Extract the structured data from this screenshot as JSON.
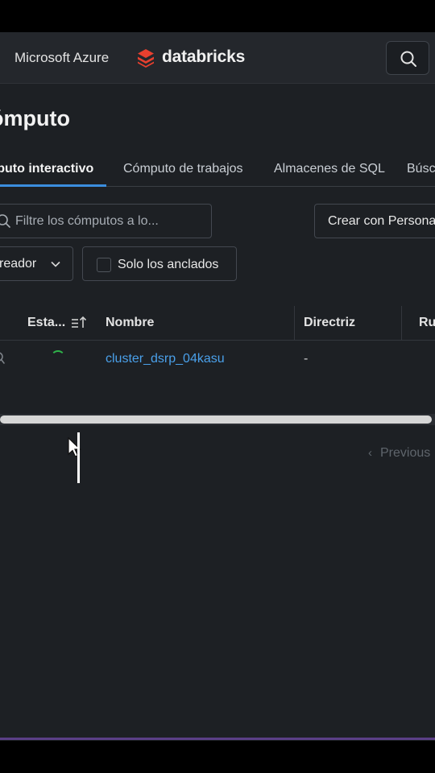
{
  "topbar": {
    "azure_label": "Microsoft Azure",
    "brand_name": "databricks",
    "brand_color": "#e8402f",
    "search_icon": "search-icon"
  },
  "page": {
    "title": "ómputo"
  },
  "tabs": [
    {
      "label": "mputo interactivo",
      "active": true
    },
    {
      "label": "Cómputo de trabajos",
      "active": false
    },
    {
      "label": "Almacenes de SQL",
      "active": false
    },
    {
      "label": "Búsc",
      "active": false
    }
  ],
  "filters": {
    "search_placeholder": "Filtre los cómputos a lo...",
    "create_label": "Crear con Persona",
    "creator_label": "reador",
    "pinned_label": "Solo los anclados",
    "pinned_checked": false
  },
  "table": {
    "headers": {
      "status": "Esta...",
      "name": "Nombre",
      "policy": "Directriz",
      "runtime": "Ru"
    },
    "rows": [
      {
        "status": "starting",
        "name": "cluster_dsrp_04kasu",
        "policy": "-"
      }
    ]
  },
  "pagination": {
    "prev_label": "Previous",
    "prev_chevron": "‹"
  },
  "colors": {
    "accent_blue": "#3b8ede",
    "link_blue": "#4aa0ea",
    "spinner_green": "#2fb34a",
    "background": "#1d2024"
  }
}
